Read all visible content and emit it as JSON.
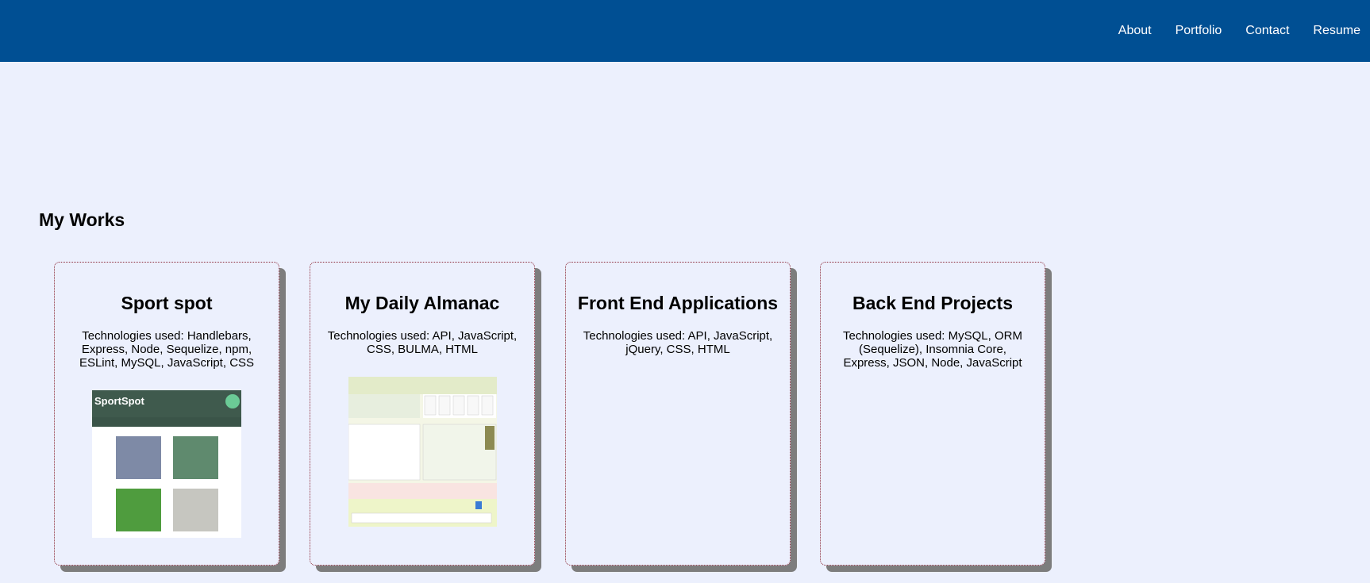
{
  "nav": {
    "items": [
      "About",
      "Portfolio",
      "Contact",
      "Resume"
    ]
  },
  "section": {
    "title": "My Works"
  },
  "cards": [
    {
      "title": "Sport spot",
      "tech": "Technologies used: Handlebars, Express, Node, Sequelize, npm, ESLint, MySQL, JavaScript, CSS",
      "image_logo": "SportSpot"
    },
    {
      "title": "My Daily Almanac",
      "tech": "Technologies used: API, JavaScript, CSS, BULMA, HTML"
    },
    {
      "title": "Front End Applications",
      "tech": "Technologies used: API, JavaScript, jQuery, CSS, HTML"
    },
    {
      "title": "Back End Projects",
      "tech": "Technologies used: MySQL, ORM (Sequelize), Insomnia Core, Express, JSON, Node, JavaScript"
    }
  ],
  "colors": {
    "header": "#004f93",
    "background": "#ecf0fd",
    "card_border": "#8c2a3a",
    "card_shadow": "#7d7d7d"
  }
}
